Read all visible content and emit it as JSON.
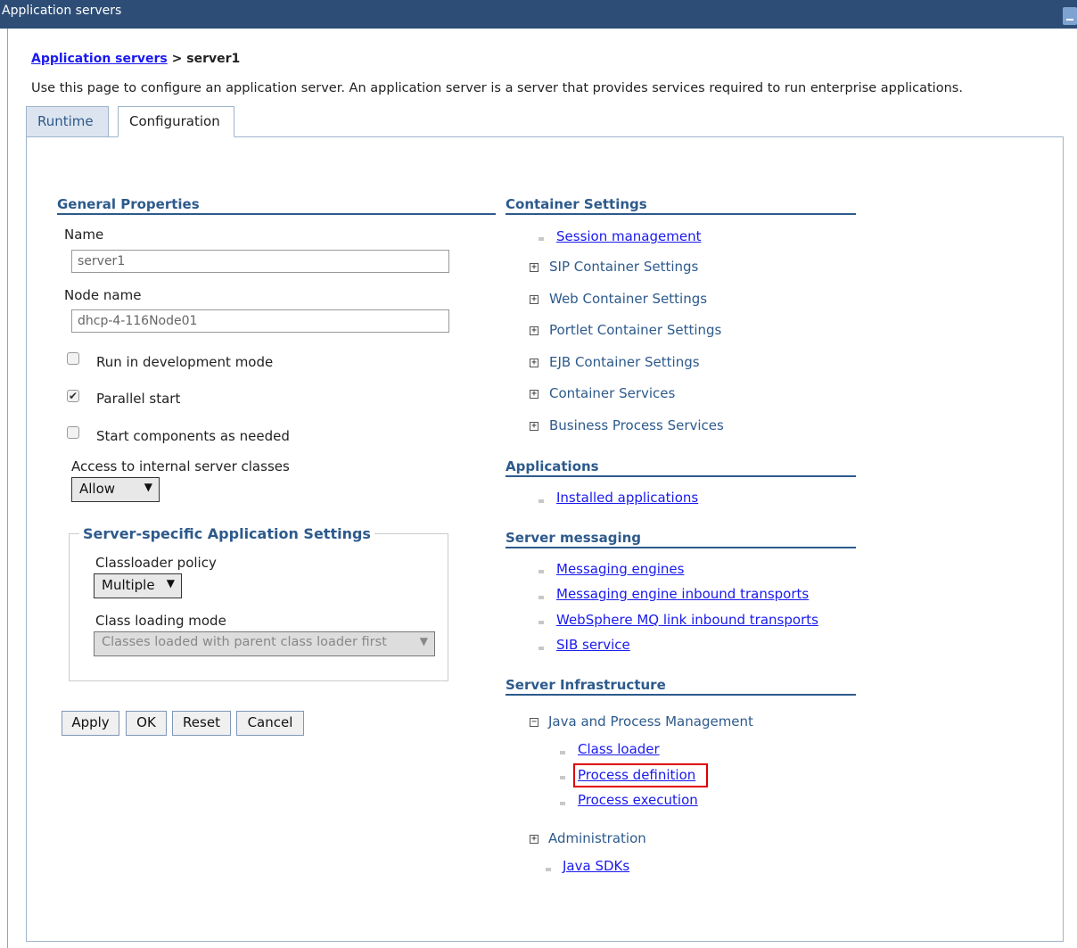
{
  "window": {
    "title": "Application servers"
  },
  "breadcrumb": {
    "parent": "Application servers",
    "separator": ">",
    "current": "server1"
  },
  "description": "Use this page to configure an application server. An application server is a server that provides services required to run enterprise applications.",
  "tabs": [
    {
      "label": "Runtime"
    },
    {
      "label": "Configuration"
    }
  ],
  "general": {
    "heading": "General Properties",
    "name_label": "Name",
    "name_value": "server1",
    "node_label": "Node name",
    "node_value": "dhcp-4-116Node01",
    "checkboxes": [
      {
        "label": "Run in development mode",
        "checked": false
      },
      {
        "label": "Parallel start",
        "checked": true
      },
      {
        "label": "Start components as needed",
        "checked": false
      }
    ],
    "access_label": "Access to internal server classes",
    "access_value": "Allow"
  },
  "app_settings": {
    "legend": "Server-specific Application Settings",
    "classloader_label": "Classloader policy",
    "classloader_value": "Multiple",
    "loading_label": "Class loading mode",
    "loading_value": "Classes loaded with parent class loader first"
  },
  "buttons": {
    "apply": "Apply",
    "ok": "OK",
    "reset": "Reset",
    "cancel": "Cancel"
  },
  "container": {
    "heading": "Container Settings",
    "link": "Session management",
    "groups": [
      "SIP Container Settings",
      "Web Container Settings",
      "Portlet Container Settings",
      "EJB Container Settings",
      "Container Services",
      "Business Process Services"
    ]
  },
  "applications": {
    "heading": "Applications",
    "link": "Installed applications"
  },
  "messaging": {
    "heading": "Server messaging",
    "links": [
      "Messaging engines",
      "Messaging engine inbound transports",
      "WebSphere MQ link inbound transports",
      "SIB service"
    ]
  },
  "infrastructure": {
    "heading": "Server Infrastructure",
    "java_group": "Java and Process Management",
    "java_links": [
      "Class loader",
      "Process definition",
      "Process execution"
    ],
    "admin_group": "Administration",
    "admin_link": "Java SDKs"
  },
  "symbols": {
    "checkmark": "✔",
    "expand": "+",
    "collapse": "−",
    "dropdown": "▼"
  },
  "colors": {
    "titlebar": "#2d4d76",
    "section": "#2d5a8c",
    "link": "#1a1aee",
    "highlight": "#e00000"
  }
}
